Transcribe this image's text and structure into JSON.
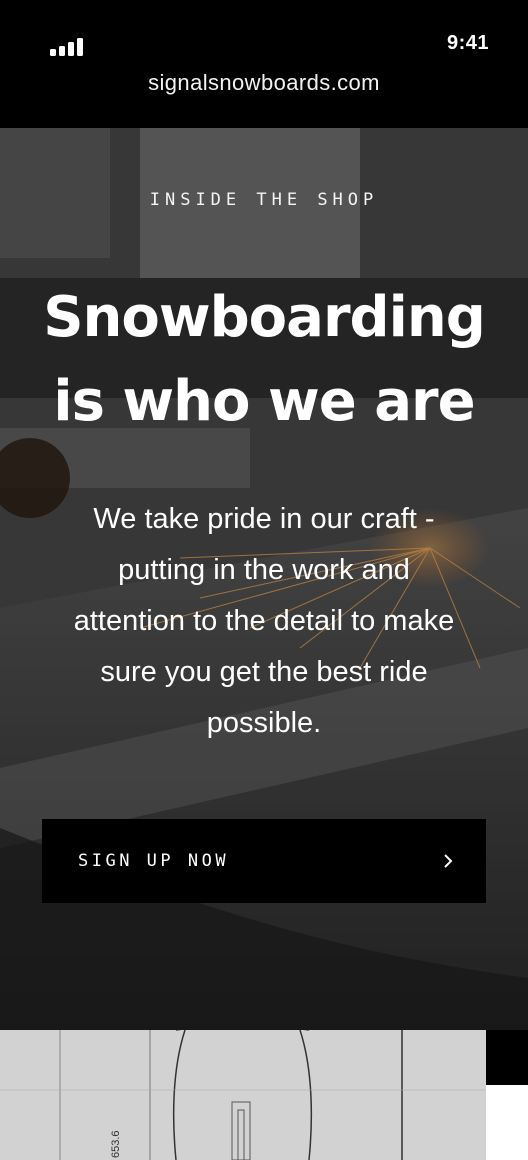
{
  "status_bar": {
    "time": "9:41",
    "url": "signalsnowboards.com",
    "signal_icon": "cellular-signal-icon"
  },
  "hero": {
    "eyebrow": "INSIDE THE SHOP",
    "headline_line1": "Snowboarding",
    "headline_line2": "is who we are",
    "body_line1": "We take pride in our craft -",
    "body_line2": "putting in the work and",
    "body_line3": "attention to the detail to make",
    "body_line4": "sure you get the best ride",
    "body_line5": "possible.",
    "cta_label": "SIGN UP NOW",
    "cta_icon": "chevron-right-icon"
  },
  "drawing": {
    "dimension_label": "653.6"
  }
}
